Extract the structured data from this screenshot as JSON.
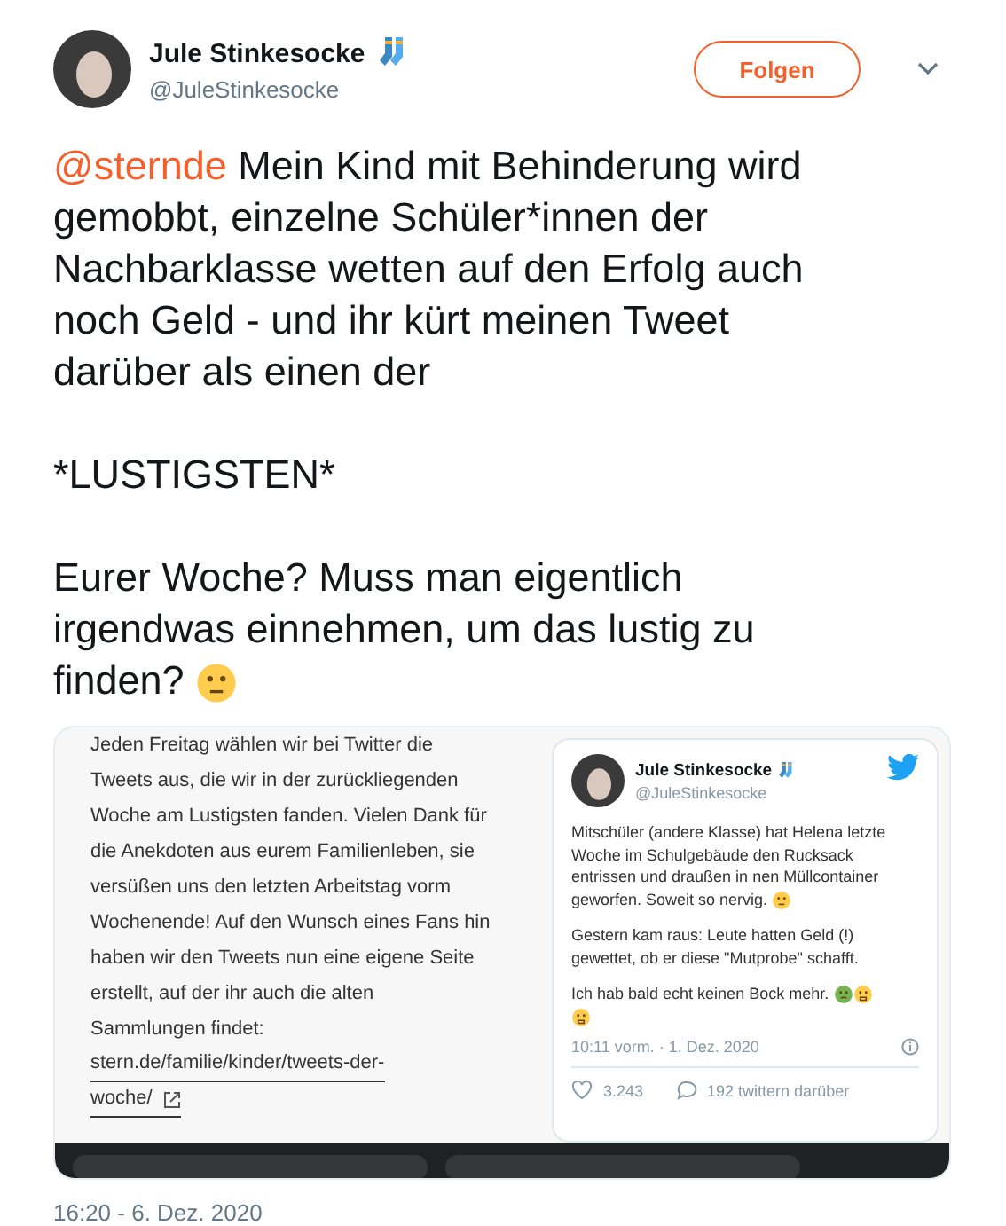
{
  "author": {
    "name": "Jule Stinkesocke",
    "handle": "@JuleStinkesocke",
    "follow_button": "Folgen"
  },
  "tweet": {
    "paragraphs": [
      {
        "mention": "@sternde",
        "text": "Mein Kind mit Behinderung wird gemobbt, einzelne Schüler*innen der Nachbarklasse wetten auf den Erfolg auch noch Geld - und ihr kürt meinen Tweet darüber als einen der"
      },
      {
        "text": "*LUSTIGSTEN*"
      },
      {
        "text": "Eurer Woche? Muss man eigentlich irgendwas einnehmen, um das lustig zu finden?"
      }
    ]
  },
  "media": {
    "article_text": "Jeden Freitag wählen wir bei Twitter die Tweets aus, die wir in der zurückliegenden Woche am Lustigsten fanden. Vielen Dank für die Anekdoten aus eurem Familienleben, sie versüßen uns den letzten Arbeitstag vorm Wochenende! Auf den Wunsch eines Fans hin haben wir den Tweets nun eine eigene Seite erstellt, auf der ihr auch die alten Sammlungen findet:",
    "link_lines": [
      "stern.de/familie/kinder/tweets-der-",
      "woche/"
    ],
    "embedded_tweet": {
      "name": "Jule Stinkesocke",
      "handle": "@JuleStinkesocke",
      "paragraphs": [
        "Mitschüler (andere Klasse) hat Helena letzte Woche im Schulgebäude den Rucksack entrissen und draußen in nen Müllcontainer geworfen. Soweit so nervig.",
        "Gestern kam raus: Leute hatten Geld (!) gewettet, ob er diese \"Mutprobe\" schafft.",
        "Ich hab bald echt keinen Bock mehr."
      ],
      "time": "10:11 vorm. · 1. Dez. 2020",
      "likes": "3.243",
      "replies": "192 twittern darüber"
    }
  },
  "timestamp": "16:20 - 6. Dez. 2020"
}
